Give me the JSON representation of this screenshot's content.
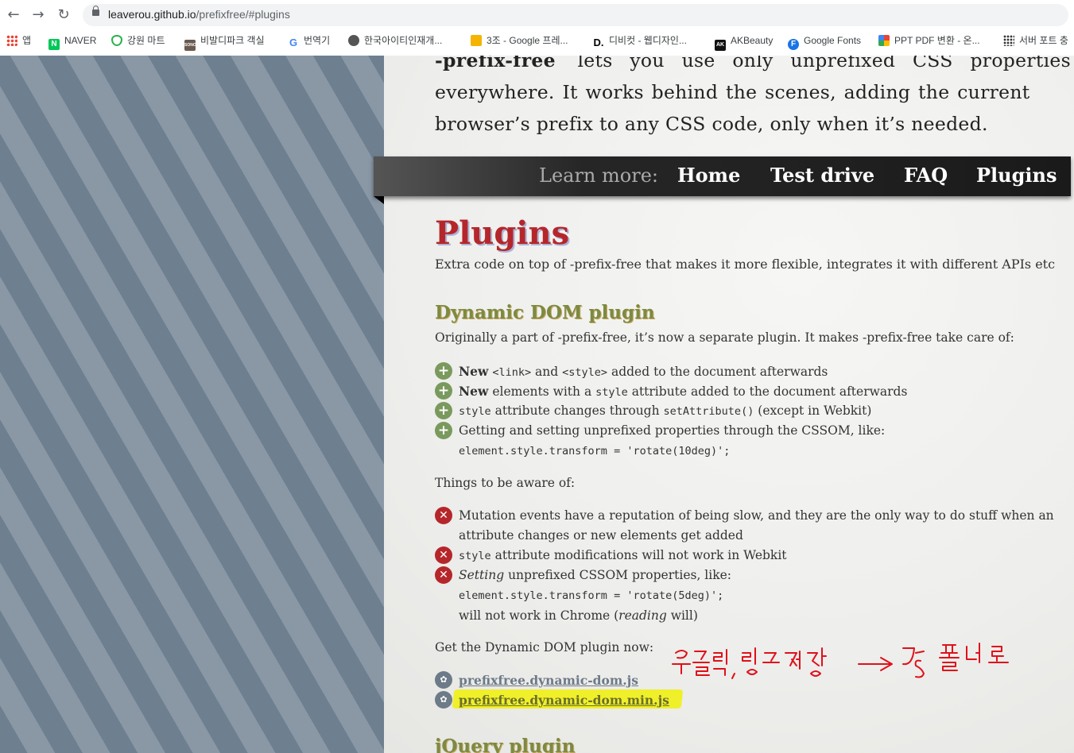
{
  "browser": {
    "url_host": "leaverou.github.io",
    "url_path": "/prefixfree/#plugins",
    "bookmarks": [
      {
        "label": "앱",
        "icon": "apps-grid-icon"
      },
      {
        "label": "NAVER",
        "icon": "naver-icon"
      },
      {
        "label": "강원 마트",
        "icon": "shield-icon"
      },
      {
        "label": "비발디파크 객실",
        "icon": "sono-icon"
      },
      {
        "label": "번역기",
        "icon": "google-icon"
      },
      {
        "label": "한국아이티인재개...",
        "icon": "globe-icon"
      },
      {
        "label": "3조 - Google 프레...",
        "icon": "slides-icon"
      },
      {
        "label": "디비컷 - 웹디자인...",
        "icon": "d-icon"
      },
      {
        "label": "AKBeauty",
        "icon": "akbeauty-icon"
      },
      {
        "label": "Google Fonts",
        "icon": "google-fonts-icon"
      },
      {
        "label": "PPT PDF 변환 - 온...",
        "icon": "ppt-icon"
      },
      {
        "label": "서버 포트 충",
        "icon": "dots-icon"
      }
    ]
  },
  "intro": {
    "brand": "-prefix-free",
    "line1_rest": "lets you use only unprefixed CSS properties",
    "line2": "everywhere. It works behind the scenes, adding the current",
    "line3": "browser’s prefix to any CSS code, only when it’s needed."
  },
  "nav": {
    "learn_more": "Learn more:",
    "links": [
      "Home",
      "Test drive",
      "FAQ",
      "Plugins"
    ]
  },
  "plugins": {
    "title": "Plugins",
    "description": "Extra code on top of -prefix-free that makes it more flexible, integrates it with different APIs etc"
  },
  "dom_plugin": {
    "title": "Dynamic DOM plugin",
    "intro": "Originally a part of -prefix-free, it’s now a separate plugin. It makes -prefix-free take care of:",
    "features": [
      {
        "bold": "New",
        "code1": "<link>",
        "mid": "and",
        "code2": "<style>",
        "rest": "added to the document afterwards"
      },
      {
        "bold": "New",
        "pre": "elements with a",
        "code": "style",
        "rest": "attribute added to the document afterwards"
      },
      {
        "code1": "style",
        "mid": "attribute changes through",
        "code2": "setAttribute()",
        "rest": "(except in Webkit)"
      },
      {
        "text": "Getting and setting unprefixed properties through the CSSOM, like:",
        "code": "element.style.transform = 'rotate(10deg)';"
      }
    ],
    "aware_label": "Things to be aware of:",
    "caveats": [
      {
        "line1": "Mutation events have a reputation of being slow, and they are the only way to do stuff when an",
        "line2": "attribute changes or new elements get added"
      },
      {
        "code": "style",
        "rest": "attribute modifications will not work in Webkit"
      },
      {
        "em": "Setting",
        "rest": "unprefixed CSSOM properties, like:",
        "code": "element.style.transform = 'rotate(5deg)';",
        "l3_pre": "will not work in Chrome (",
        "l3_em": "reading",
        "l3_post": " will)"
      }
    ],
    "get_label": "Get the Dynamic DOM plugin now:",
    "downloads": [
      "prefixfree.dynamic-dom.js",
      "prefixfree.dynamic-dom.min.js"
    ]
  },
  "jquery_plugin": {
    "title": "jQuery plugin"
  },
  "annotation": {
    "handwritten_note": "우클릭, 링크저장 → JS 폴더로",
    "highlight_color": "#f0f020",
    "ink_color": "#e0101a"
  },
  "colors": {
    "heading_red": "#b5262a",
    "heading_olive": "#7d8a42",
    "plus_green": "#7a9a5d",
    "link_slate": "#6d7a88"
  }
}
